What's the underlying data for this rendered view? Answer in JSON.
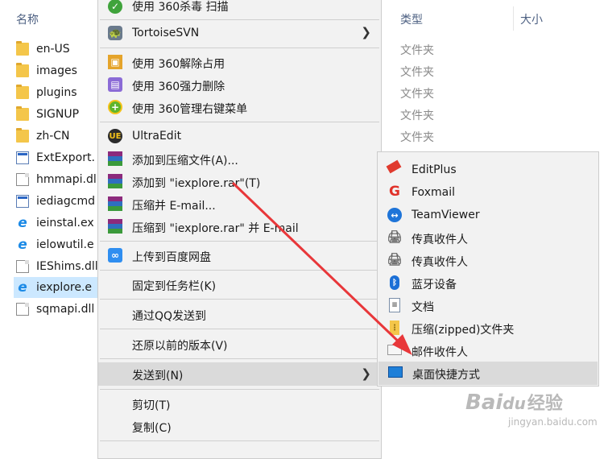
{
  "explorer": {
    "columns": {
      "name": "名称",
      "type": "类型",
      "size": "大小"
    },
    "files": [
      {
        "name": "en-US",
        "icon": "folder-icon"
      },
      {
        "name": "images",
        "icon": "folder-icon"
      },
      {
        "name": "plugins",
        "icon": "folder-icon"
      },
      {
        "name": "SIGNUP",
        "icon": "folder-icon"
      },
      {
        "name": "zh-CN",
        "icon": "folder-icon"
      },
      {
        "name": "ExtExport.",
        "icon": "exe-icon"
      },
      {
        "name": "hmmapi.dl",
        "icon": "dll-icon"
      },
      {
        "name": "iediagcmd",
        "icon": "diag-icon"
      },
      {
        "name": "ieinstal.ex",
        "icon": "ie-icon"
      },
      {
        "name": "ielowutil.e",
        "icon": "ie-icon"
      },
      {
        "name": "IEShims.dll",
        "icon": "dll-icon"
      },
      {
        "name": "iexplore.e",
        "icon": "ie-icon"
      },
      {
        "name": "sqmapi.dll",
        "icon": "dll-icon"
      }
    ],
    "types": [
      "文件夹",
      "文件夹",
      "文件夹",
      "文件夹",
      "文件夹"
    ]
  },
  "context_menu": {
    "items": [
      {
        "label": "使用 360杀毒 扫描",
        "icon": "360-antivirus-icon"
      },
      {
        "label": "TortoiseSVN",
        "icon": "tortoisesvn-icon"
      },
      {
        "label": "使用 360解除占用",
        "icon": "360-unlock-icon"
      },
      {
        "label": "使用 360强力删除",
        "icon": "360-shred-icon"
      },
      {
        "label": "使用 360管理右键菜单",
        "icon": "360-menu-manager-icon"
      },
      {
        "label": "UltraEdit",
        "icon": "ultraedit-icon"
      },
      {
        "label": "添加到压缩文件(A)...",
        "icon": "winrar-icon"
      },
      {
        "label": "添加到 \"iexplore.rar\"(T)",
        "icon": "winrar-icon"
      },
      {
        "label": "压缩并 E-mail...",
        "icon": "winrar-icon"
      },
      {
        "label": "压缩到 \"iexplore.rar\" 并 E-mail",
        "icon": "winrar-icon"
      },
      {
        "label": "上传到百度网盘",
        "icon": "baidu-netdisk-icon"
      },
      {
        "label": "固定到任务栏(K)",
        "icon": ""
      },
      {
        "label": "通过QQ发送到",
        "icon": ""
      },
      {
        "label": "还原以前的版本(V)",
        "icon": ""
      },
      {
        "label": "发送到(N)",
        "icon": ""
      },
      {
        "label": "剪切(T)",
        "icon": ""
      },
      {
        "label": "复制(C)",
        "icon": ""
      }
    ]
  },
  "send_to_menu": {
    "items": [
      {
        "label": "EditPlus",
        "icon": "editplus-icon"
      },
      {
        "label": "Foxmail",
        "icon": "foxmail-icon"
      },
      {
        "label": "TeamViewer",
        "icon": "teamviewer-icon"
      },
      {
        "label": "传真收件人",
        "icon": "fax-icon"
      },
      {
        "label": "传真收件人",
        "icon": "fax-icon"
      },
      {
        "label": "蓝牙设备",
        "icon": "bluetooth-icon"
      },
      {
        "label": "文档",
        "icon": "documents-icon"
      },
      {
        "label": "压缩(zipped)文件夹",
        "icon": "zip-folder-icon"
      },
      {
        "label": "邮件收件人",
        "icon": "mail-recipient-icon"
      },
      {
        "label": "桌面快捷方式",
        "icon": "desktop-icon"
      }
    ]
  },
  "watermark": {
    "brand": "Bai",
    "paw": "du",
    "suffix": "经验",
    "url": "jingyan.baidu.com"
  },
  "colors": {
    "selection": "#cce8ff",
    "menu_bg": "#f2f2f2",
    "menu_highlight": "#dadada",
    "arrow": "#e8373a"
  }
}
